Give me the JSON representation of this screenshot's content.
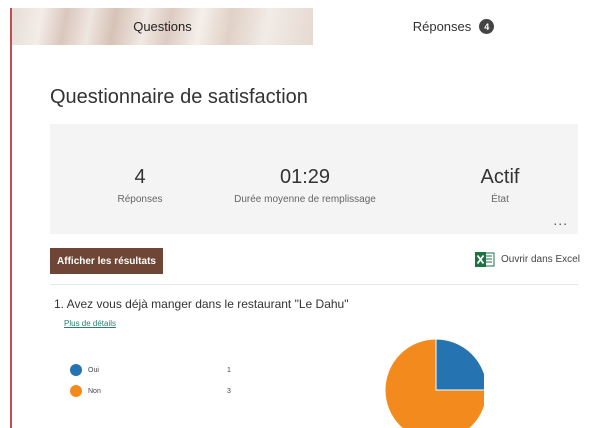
{
  "tabs": {
    "questions": "Questions",
    "reponses": "Réponses",
    "reponses_badge": "4"
  },
  "form_title": "Questionnaire de satisfaction",
  "stats": {
    "responses_value": "4",
    "responses_label": "Réponses",
    "duration_value": "01:29",
    "duration_label": "Durée moyenne de remplissage",
    "status_value": "Actif",
    "status_label": "État",
    "more": "..."
  },
  "actions": {
    "show_results": "Afficher les résultats",
    "open_excel": "Ouvrir dans Excel"
  },
  "question": {
    "text": "1.  Avez vous déjà manger dans le restaurant \"Le Dahu\"",
    "details_link": "Plus de détails"
  },
  "chart_data": {
    "type": "pie",
    "categories": [
      "Oui",
      "Non"
    ],
    "values": [
      1,
      3
    ],
    "colors": [
      "#2673b1",
      "#f28a1e"
    ]
  },
  "icons": {
    "excel": "excel-icon",
    "more": "more-options-icon"
  }
}
